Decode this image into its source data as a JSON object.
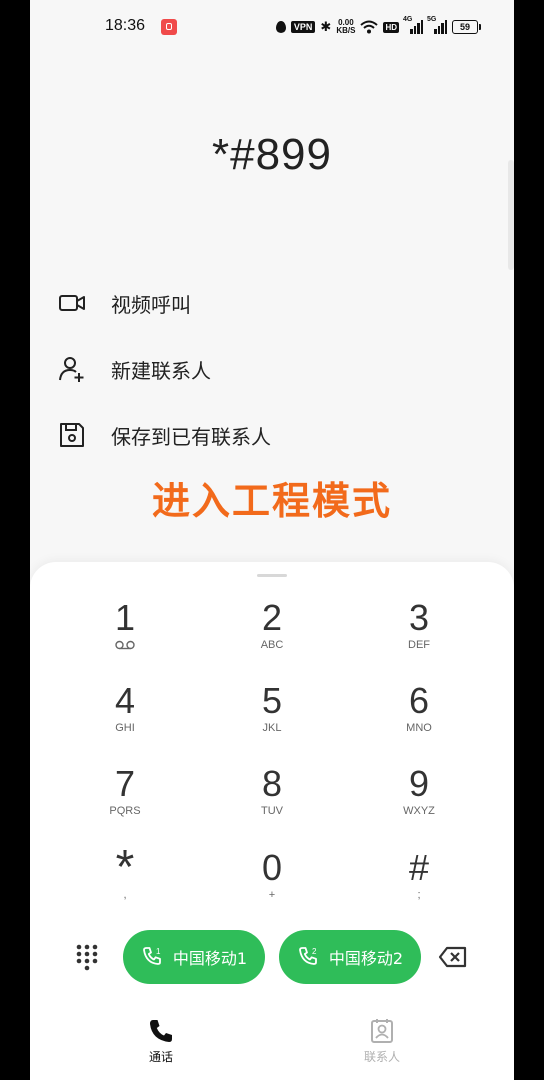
{
  "status_bar": {
    "time": "18:36",
    "vpn": "VPN",
    "net_speed_value": "0.00",
    "net_speed_unit": "KB/S",
    "hd": "HD",
    "signal1": "4G",
    "signal2": "5G",
    "battery": "59"
  },
  "dialed_number": "*#899",
  "options": [
    {
      "label": "视频呼叫",
      "icon": "video-camera-icon"
    },
    {
      "label": "新建联系人",
      "icon": "add-person-icon"
    },
    {
      "label": "保存到已有联系人",
      "icon": "save-icon"
    }
  ],
  "overlay_hint": "进入工程模式",
  "keypad": [
    {
      "digit": "1",
      "letters": "",
      "icon": "voicemail-icon"
    },
    {
      "digit": "2",
      "letters": "ABC"
    },
    {
      "digit": "3",
      "letters": "DEF"
    },
    {
      "digit": "4",
      "letters": "GHI"
    },
    {
      "digit": "5",
      "letters": "JKL"
    },
    {
      "digit": "6",
      "letters": "MNO"
    },
    {
      "digit": "7",
      "letters": "PQRS"
    },
    {
      "digit": "8",
      "letters": "TUV"
    },
    {
      "digit": "9",
      "letters": "WXYZ"
    },
    {
      "digit": "*",
      "letters": ","
    },
    {
      "digit": "0",
      "letters": "+"
    },
    {
      "digit": "#",
      "letters": ";"
    }
  ],
  "call_buttons": [
    {
      "label": "中国移动1",
      "sim": "1"
    },
    {
      "label": "中国移动2",
      "sim": "2"
    }
  ],
  "nav": {
    "calls_label": "通话",
    "contacts_label": "联系人",
    "active_color": "#111111",
    "inactive_color": "#b0b0b0"
  },
  "colors": {
    "call_green": "#2fbd59",
    "hint_orange": "#f26a1b"
  }
}
